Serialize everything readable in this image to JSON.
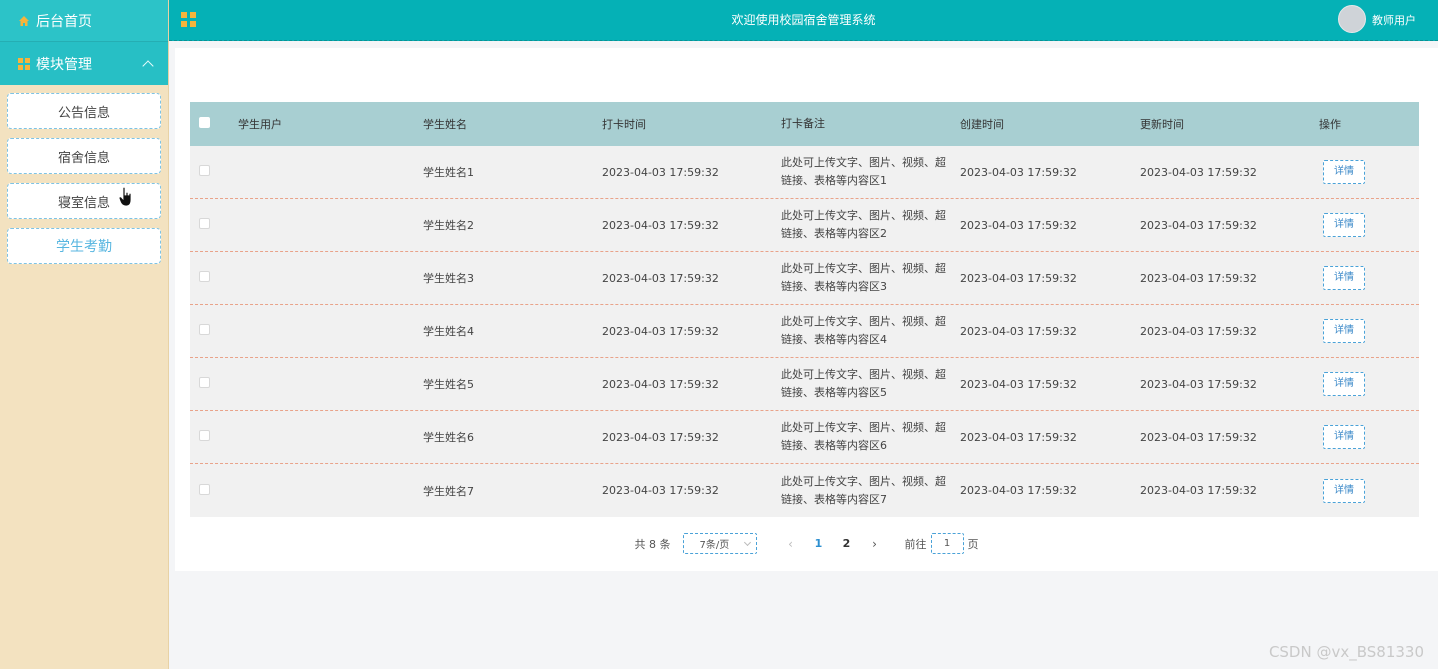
{
  "sidebar": {
    "home_label": "后台首页",
    "module_label": "模块管理",
    "items": [
      {
        "label": "公告信息"
      },
      {
        "label": "宿舍信息"
      },
      {
        "label": "寝室信息"
      },
      {
        "label": "学生考勤"
      }
    ]
  },
  "header": {
    "title": "欢迎使用校园宿舍管理系统",
    "user": "教师用户"
  },
  "table": {
    "columns": [
      "学生用户",
      "学生姓名",
      "打卡时间",
      "打卡备注",
      "创建时间",
      "更新时间",
      "操作"
    ],
    "rows": [
      {
        "user": "",
        "name": "学生姓名1",
        "time": "2023-04-03 17:59:32",
        "note": "此处可上传文字、图片、视频、超链接、表格等内容区1",
        "created": "2023-04-03 17:59:32",
        "updated": "2023-04-03 17:59:32",
        "action": "详情"
      },
      {
        "user": "",
        "name": "学生姓名2",
        "time": "2023-04-03 17:59:32",
        "note": "此处可上传文字、图片、视频、超链接、表格等内容区2",
        "created": "2023-04-03 17:59:32",
        "updated": "2023-04-03 17:59:32",
        "action": "详情"
      },
      {
        "user": "",
        "name": "学生姓名3",
        "time": "2023-04-03 17:59:32",
        "note": "此处可上传文字、图片、视频、超链接、表格等内容区3",
        "created": "2023-04-03 17:59:32",
        "updated": "2023-04-03 17:59:32",
        "action": "详情"
      },
      {
        "user": "",
        "name": "学生姓名4",
        "time": "2023-04-03 17:59:32",
        "note": "此处可上传文字、图片、视频、超链接、表格等内容区4",
        "created": "2023-04-03 17:59:32",
        "updated": "2023-04-03 17:59:32",
        "action": "详情"
      },
      {
        "user": "",
        "name": "学生姓名5",
        "time": "2023-04-03 17:59:32",
        "note": "此处可上传文字、图片、视频、超链接、表格等内容区5",
        "created": "2023-04-03 17:59:32",
        "updated": "2023-04-03 17:59:32",
        "action": "详情"
      },
      {
        "user": "",
        "name": "学生姓名6",
        "time": "2023-04-03 17:59:32",
        "note": "此处可上传文字、图片、视频、超链接、表格等内容区6",
        "created": "2023-04-03 17:59:32",
        "updated": "2023-04-03 17:59:32",
        "action": "详情"
      },
      {
        "user": "",
        "name": "学生姓名7",
        "time": "2023-04-03 17:59:32",
        "note": "此处可上传文字、图片、视频、超链接、表格等内容区7",
        "created": "2023-04-03 17:59:32",
        "updated": "2023-04-03 17:59:32",
        "action": "详情"
      }
    ]
  },
  "pager": {
    "total": "共 8 条",
    "page_size": "7条/页",
    "pages": [
      "1",
      "2"
    ],
    "current": "1",
    "goto_prefix": "前往",
    "goto_value": "1",
    "goto_suffix": "页"
  },
  "watermark": "CSDN @vx_BS81330",
  "colors": {
    "accent": "#05b1b6",
    "sidebar_bg": "#f3e2c0",
    "table_header": "#a8cfd2",
    "link": "#2d8fd0"
  }
}
